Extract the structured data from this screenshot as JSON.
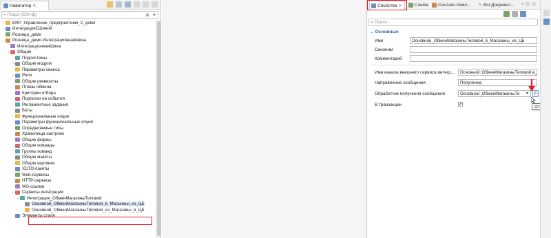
{
  "colors": {
    "accent": "#2c5aa0",
    "highlight": "#e0202a",
    "selection": "#dce8f7"
  },
  "navigator": {
    "tab_title": "Навигатор",
    "tab_close": "✕",
    "search_placeholder": "Поиск (Ctrl+ф)",
    "tree": [
      {
        "level": 0,
        "label": "ERP_Управление_предприятием_2_демо",
        "twisty": "›",
        "icon": "config-icon"
      },
      {
        "level": 0,
        "label": "ИнтеграцияСШиной",
        "twisty": "›",
        "icon": "config-icon"
      },
      {
        "level": 0,
        "label": "Розница_демо",
        "twisty": "",
        "icon": "config-icon"
      },
      {
        "level": 0,
        "label": "Розница_демо.ИнтеграционнаяШина",
        "twisty": "⌄",
        "icon": "config-icon"
      },
      {
        "level": 1,
        "label": "ИнтеграционнаяШина",
        "twisty": "",
        "icon": "bus-icon"
      },
      {
        "level": 1,
        "label": "Общие",
        "twisty": "⌄",
        "icon": "common-icon"
      },
      {
        "level": 2,
        "label": "Подсистемы",
        "twisty": "",
        "icon": "subsystems-icon"
      },
      {
        "level": 2,
        "label": "Общие модули",
        "twisty": "›",
        "icon": "modules-icon"
      },
      {
        "level": 2,
        "label": "Параметры сеанса",
        "twisty": "",
        "icon": "params-icon"
      },
      {
        "level": 2,
        "label": "Роли",
        "twisty": "›",
        "icon": "roles-icon"
      },
      {
        "level": 2,
        "label": "Общие реквизиты",
        "twisty": "",
        "icon": "attributes-icon"
      },
      {
        "level": 2,
        "label": "Планы обмена",
        "twisty": "",
        "icon": "exchange-icon"
      },
      {
        "level": 2,
        "label": "Критерии отбора",
        "twisty": "",
        "icon": "filter-icon"
      },
      {
        "level": 2,
        "label": "Подписки на события",
        "twisty": "",
        "icon": "events-icon"
      },
      {
        "level": 2,
        "label": "Регламентные задания",
        "twisty": "",
        "icon": "jobs-icon"
      },
      {
        "level": 2,
        "label": "Боты",
        "twisty": "",
        "icon": "bots-icon"
      },
      {
        "level": 2,
        "label": "Функциональные опции",
        "twisty": "",
        "icon": "options-icon"
      },
      {
        "level": 2,
        "label": "Параметры функциональных опций",
        "twisty": "",
        "icon": "options-params-icon"
      },
      {
        "level": 2,
        "label": "Определяемые типы",
        "twisty": "",
        "icon": "types-icon"
      },
      {
        "level": 2,
        "label": "Хранилища настроек",
        "twisty": "",
        "icon": "storage-icon"
      },
      {
        "level": 2,
        "label": "Общие формы",
        "twisty": "",
        "icon": "forms-icon"
      },
      {
        "level": 2,
        "label": "Общие команды",
        "twisty": "",
        "icon": "commands-icon"
      },
      {
        "level": 2,
        "label": "Группы команд",
        "twisty": "",
        "icon": "command-groups-icon"
      },
      {
        "level": 2,
        "label": "Общие макеты",
        "twisty": "",
        "icon": "templates-icon"
      },
      {
        "level": 2,
        "label": "Общие картинки",
        "twisty": "",
        "icon": "pictures-icon"
      },
      {
        "level": 2,
        "label": "XDTO-пакеты",
        "twisty": "",
        "icon": "xdto-icon"
      },
      {
        "level": 2,
        "label": "Web-сервисы",
        "twisty": "",
        "icon": "web-services-icon"
      },
      {
        "level": 2,
        "label": "HTTP-сервисы",
        "twisty": "",
        "icon": "http-services-icon"
      },
      {
        "level": 2,
        "label": "WS-ссылки",
        "twisty": "",
        "icon": "ws-links-icon"
      },
      {
        "level": 2,
        "label": "Сервисы интеграции",
        "twisty": "⌄",
        "icon": "integration-icon"
      },
      {
        "level": 3,
        "label": "Интеграция_ОбменМагазиныТиповой",
        "twisty": "⌄",
        "icon": "integration-service-icon"
      },
      {
        "level": 4,
        "label": "Основной_ОбменМагазиныТиповой_в_Магазины_из_ЦБ",
        "twisty": "",
        "icon": "channel-icon",
        "selected": true
      },
      {
        "level": 4,
        "label": "Основной_ОбменМагазиныТиповой_из_Магазины_в_ЦБ",
        "twisty": "",
        "icon": "channel-icon"
      },
      {
        "level": 2,
        "label": "Элементы стиля",
        "twisty": "",
        "icon": "style-icon"
      }
    ]
  },
  "properties": {
    "tabs": [
      {
        "label": "Свойства",
        "icon": "properties-icon",
        "active": true
      },
      {
        "label": "Схема",
        "icon": "schema-icon"
      },
      {
        "label": "Синтакс-помо...",
        "icon": "syntax-help-icon"
      },
      {
        "label": "Bsl Документ...",
        "icon": "bsl-doc-icon"
      }
    ],
    "search_placeholder": "Поиск...",
    "section_title": "Основные",
    "fields": {
      "name_label": "Имя",
      "name_value": "Основной_ОбменМагазиныТиповой_в_Магазины_из_ЦБ",
      "synonym_label": "Синоним",
      "synonym_value": "",
      "comment_label": "Комментарий",
      "comment_value": "",
      "external_channel_label": "Имя канала внешнего сервиса интегр...",
      "external_channel_value": "Основной::ОбменМагазиныТиповой.в_",
      "direction_label": "Направление сообщения",
      "direction_value": "Получение",
      "handler_label": "Обработчик получения сообщения",
      "handler_value": "Основной_ОбменМагазиныТи",
      "transaction_label": "В транзакции",
      "transaction_checked": "✔"
    },
    "tooltip": "Открыть"
  }
}
